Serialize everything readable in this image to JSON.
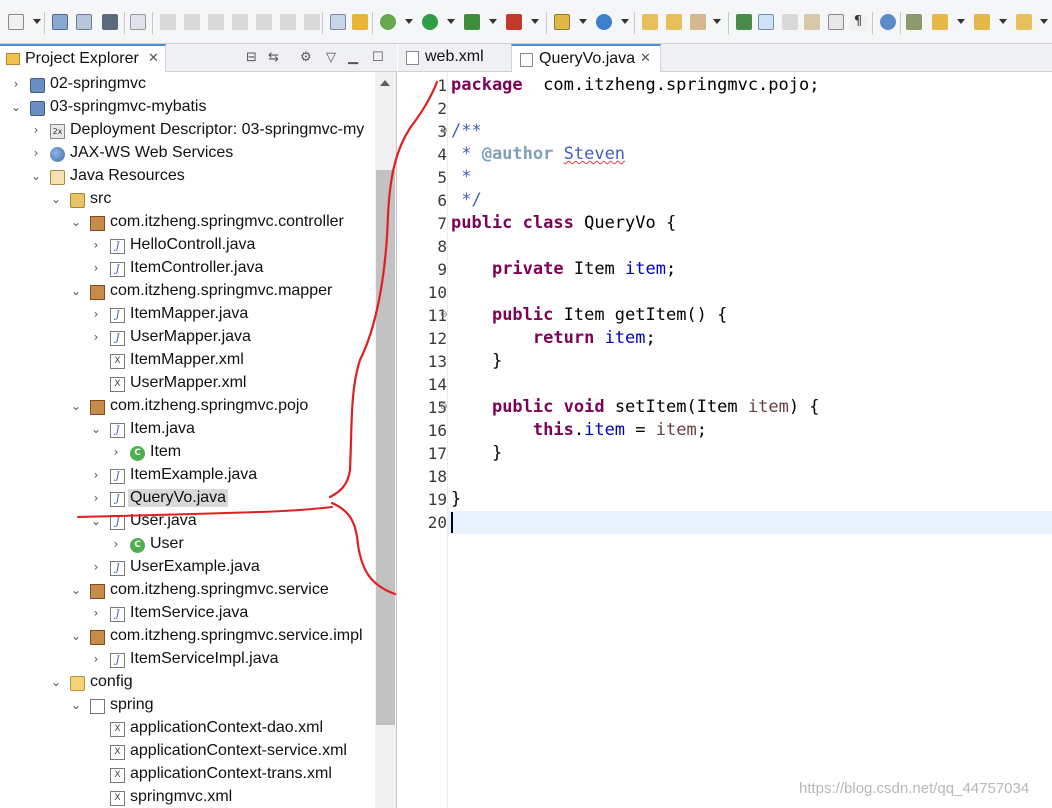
{
  "explorer": {
    "title": "Project Explorer",
    "tree": [
      {
        "label": "02-springmvc",
        "depth": 0,
        "twisty": "collapsed",
        "icon": "project-icon"
      },
      {
        "label": "03-springmvc-mybatis",
        "depth": 0,
        "twisty": "expanded",
        "icon": "project-icon"
      },
      {
        "label": "Deployment Descriptor: 03-springmvc-my",
        "depth": 1,
        "twisty": "collapsed",
        "icon": "deployment-descriptor-icon"
      },
      {
        "label": "JAX-WS Web Services",
        "depth": 1,
        "twisty": "collapsed",
        "icon": "web-services-icon"
      },
      {
        "label": "Java Resources",
        "depth": 1,
        "twisty": "expanded",
        "icon": "java-resources-icon"
      },
      {
        "label": "src",
        "depth": 2,
        "twisty": "expanded",
        "icon": "source-folder-icon"
      },
      {
        "label": "com.itzheng.springmvc.controller",
        "depth": 3,
        "twisty": "expanded",
        "icon": "package-icon"
      },
      {
        "label": "HelloControll.java",
        "depth": 4,
        "twisty": "collapsed",
        "icon": "java-file-icon"
      },
      {
        "label": "ItemController.java",
        "depth": 4,
        "twisty": "collapsed",
        "icon": "java-file-icon"
      },
      {
        "label": "com.itzheng.springmvc.mapper",
        "depth": 3,
        "twisty": "expanded",
        "icon": "package-icon"
      },
      {
        "label": "ItemMapper.java",
        "depth": 4,
        "twisty": "collapsed",
        "icon": "java-file-icon"
      },
      {
        "label": "UserMapper.java",
        "depth": 4,
        "twisty": "collapsed",
        "icon": "java-file-icon"
      },
      {
        "label": "ItemMapper.xml",
        "depth": 4,
        "twisty": "none",
        "icon": "xml-file-icon"
      },
      {
        "label": "UserMapper.xml",
        "depth": 4,
        "twisty": "none",
        "icon": "xml-file-icon"
      },
      {
        "label": "com.itzheng.springmvc.pojo",
        "depth": 3,
        "twisty": "expanded",
        "icon": "package-icon"
      },
      {
        "label": "Item.java",
        "depth": 4,
        "twisty": "expanded",
        "icon": "java-file-icon"
      },
      {
        "label": "Item",
        "depth": 5,
        "twisty": "collapsed",
        "icon": "class-icon"
      },
      {
        "label": "ItemExample.java",
        "depth": 4,
        "twisty": "collapsed",
        "icon": "java-file-icon"
      },
      {
        "label": "QueryVo.java",
        "depth": 4,
        "twisty": "collapsed",
        "icon": "java-file-icon",
        "selected": true
      },
      {
        "label": "User.java",
        "depth": 4,
        "twisty": "expanded",
        "icon": "java-file-icon"
      },
      {
        "label": "User",
        "depth": 5,
        "twisty": "collapsed",
        "icon": "class-icon"
      },
      {
        "label": "UserExample.java",
        "depth": 4,
        "twisty": "collapsed",
        "icon": "java-file-icon"
      },
      {
        "label": "com.itzheng.springmvc.service",
        "depth": 3,
        "twisty": "expanded",
        "icon": "package-icon"
      },
      {
        "label": "ItemService.java",
        "depth": 4,
        "twisty": "collapsed",
        "icon": "java-file-icon"
      },
      {
        "label": "com.itzheng.springmvc.service.impl",
        "depth": 3,
        "twisty": "expanded",
        "icon": "package-icon"
      },
      {
        "label": "ItemServiceImpl.java",
        "depth": 4,
        "twisty": "collapsed",
        "icon": "java-file-icon"
      },
      {
        "label": "config",
        "depth": 2,
        "twisty": "expanded",
        "icon": "folder-icon"
      },
      {
        "label": "spring",
        "depth": 3,
        "twisty": "expanded",
        "icon": "spring-folder-icon"
      },
      {
        "label": "applicationContext-dao.xml",
        "depth": 4,
        "twisty": "none",
        "icon": "xml-file-icon"
      },
      {
        "label": "applicationContext-service.xml",
        "depth": 4,
        "twisty": "none",
        "icon": "xml-file-icon"
      },
      {
        "label": "applicationContext-trans.xml",
        "depth": 4,
        "twisty": "none",
        "icon": "xml-file-icon"
      },
      {
        "label": "springmvc.xml",
        "depth": 4,
        "twisty": "none",
        "icon": "xml-file-icon"
      }
    ]
  },
  "editor": {
    "tabs": [
      {
        "label": "web.xml",
        "active": false
      },
      {
        "label": "QueryVo.java",
        "active": true
      }
    ],
    "lines": [
      {
        "n": "1",
        "tokens": [
          [
            "kw",
            "package"
          ],
          [
            "",
            "  com.itzheng.springmvc.pojo;"
          ]
        ]
      },
      {
        "n": "2",
        "tokens": []
      },
      {
        "n": "3",
        "fold": true,
        "tokens": [
          [
            "cm",
            "/**"
          ]
        ]
      },
      {
        "n": "4",
        "tokens": [
          [
            "cm",
            " * "
          ],
          [
            "tag",
            "@author"
          ],
          [
            "cm",
            " "
          ],
          [
            "cm squig",
            "Steven"
          ]
        ]
      },
      {
        "n": "5",
        "tokens": [
          [
            "cm",
            " *"
          ]
        ]
      },
      {
        "n": "6",
        "tokens": [
          [
            "cm",
            " */"
          ]
        ]
      },
      {
        "n": "7",
        "tokens": [
          [
            "kw",
            "public"
          ],
          [
            "",
            " "
          ],
          [
            "kw",
            "class"
          ],
          [
            "",
            " QueryVo {"
          ]
        ]
      },
      {
        "n": "8",
        "tokens": []
      },
      {
        "n": "9",
        "tokens": [
          [
            "",
            "    "
          ],
          [
            "kw",
            "private"
          ],
          [
            "",
            " Item "
          ],
          [
            "fld",
            "item"
          ],
          [
            "",
            ";"
          ]
        ]
      },
      {
        "n": "10",
        "tokens": []
      },
      {
        "n": "11",
        "fold": true,
        "tokens": [
          [
            "",
            "    "
          ],
          [
            "kw",
            "public"
          ],
          [
            "",
            " Item getItem() {"
          ]
        ]
      },
      {
        "n": "12",
        "tokens": [
          [
            "",
            "        "
          ],
          [
            "kw",
            "return"
          ],
          [
            "",
            " "
          ],
          [
            "fld",
            "item"
          ],
          [
            "",
            ";"
          ]
        ]
      },
      {
        "n": "13",
        "tokens": [
          [
            "",
            "    }"
          ]
        ]
      },
      {
        "n": "14",
        "tokens": []
      },
      {
        "n": "15",
        "fold": true,
        "tokens": [
          [
            "",
            "    "
          ],
          [
            "kw",
            "public"
          ],
          [
            "",
            " "
          ],
          [
            "kw",
            "void"
          ],
          [
            "",
            " setItem(Item "
          ],
          [
            "param",
            "item"
          ],
          [
            "",
            ") {"
          ]
        ]
      },
      {
        "n": "16",
        "tokens": [
          [
            "",
            "        "
          ],
          [
            "kw",
            "this"
          ],
          [
            "",
            "."
          ],
          [
            "fld",
            "item"
          ],
          [
            "",
            " = "
          ],
          [
            "param",
            "item"
          ],
          [
            "",
            ";"
          ]
        ]
      },
      {
        "n": "17",
        "tokens": [
          [
            "",
            "    }"
          ]
        ]
      },
      {
        "n": "18",
        "tokens": []
      },
      {
        "n": "19",
        "tokens": [
          [
            "",
            "}"
          ]
        ]
      },
      {
        "n": "20",
        "tokens": []
      }
    ]
  },
  "watermark": "https://blog.csdn.net/qq_44757034",
  "colors": {
    "keyword": "#7f0055",
    "comment": "#3f5fbf",
    "field": "#0000c0",
    "annotation": "#e02020"
  }
}
